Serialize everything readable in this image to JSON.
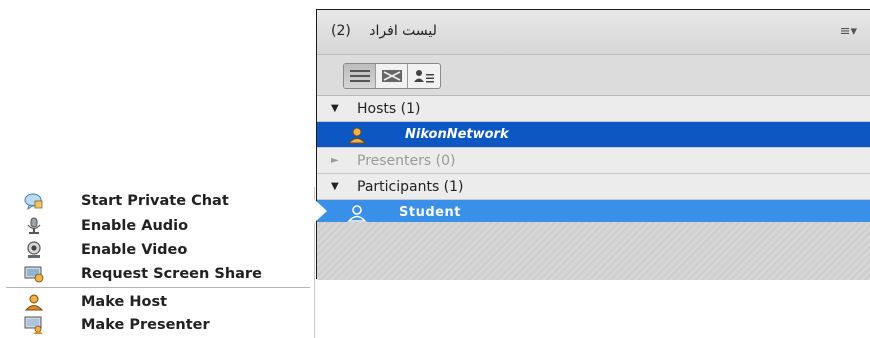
{
  "pod": {
    "count": "(2)",
    "title": "لیست افراد",
    "menu_icon": "menu-lines-icon",
    "menu_glyph": "≡▾",
    "view_buttons": [
      {
        "icon": "list-view-icon"
      },
      {
        "icon": "grid-view-icon"
      },
      {
        "icon": "user-list-icon"
      }
    ],
    "groups": {
      "hosts": "Hosts (1)",
      "presenters": "Presenters (0)",
      "participants": "Participants (1)"
    },
    "users": {
      "host": "NikonNetwork",
      "participant": "Student"
    }
  },
  "context_menu": {
    "items": [
      {
        "label": "Start Private Chat",
        "icon": "chat-bubble-icon"
      },
      {
        "label": "Enable Audio",
        "icon": "microphone-icon"
      },
      {
        "label": "Enable Video",
        "icon": "webcam-icon"
      },
      {
        "label": "Request Screen Share",
        "icon": "screen-share-icon"
      },
      {
        "label": "Make Host",
        "icon": "host-user-icon"
      },
      {
        "label": "Make Presenter",
        "icon": "presenter-icon"
      }
    ]
  },
  "colors": {
    "host_row": "#0d57c2",
    "selected_row": "#3a8fe8",
    "pod_bg": "#2a2a2a"
  }
}
